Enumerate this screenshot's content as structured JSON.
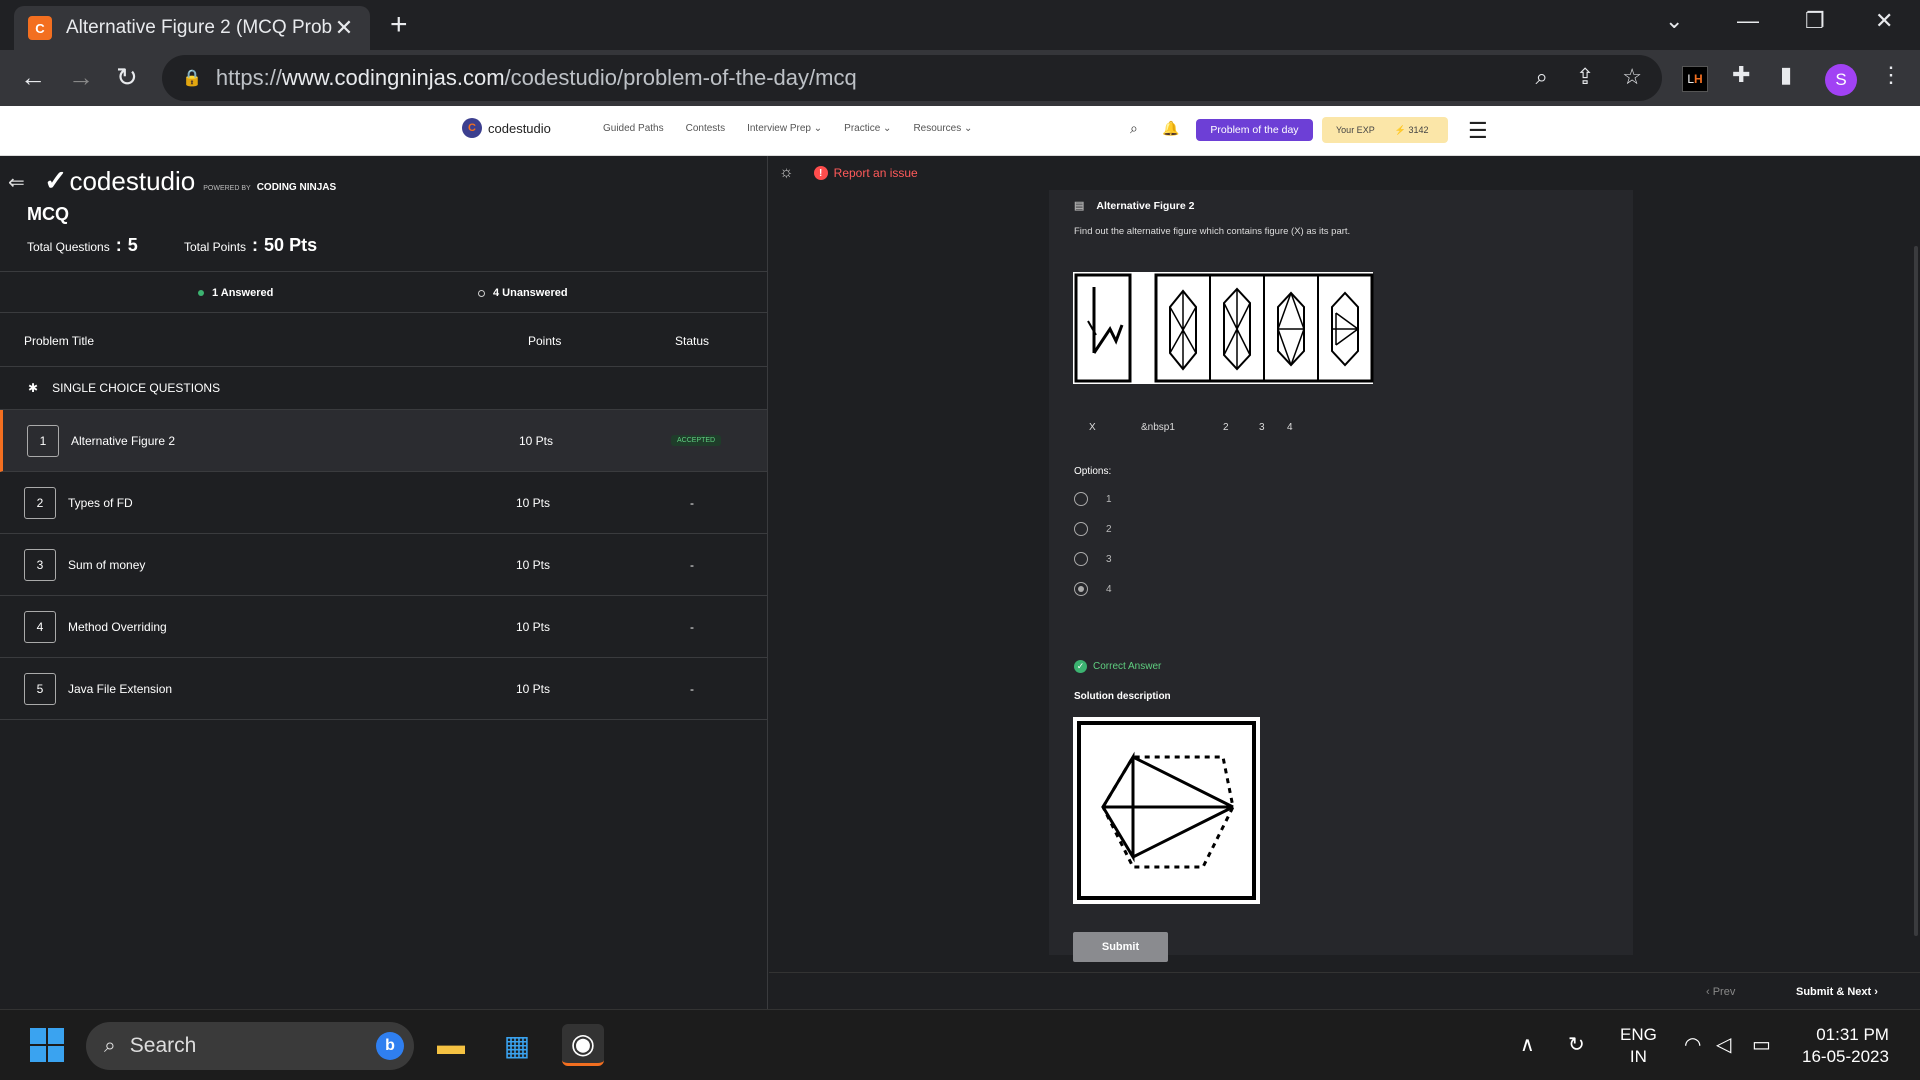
{
  "browser": {
    "tab_title": "Alternative Figure 2 (MCQ Proble",
    "tab_close": "✕",
    "new_tab": "+",
    "url_prefix": "https://",
    "url_domain": "www.codingninjas.com",
    "url_path": "/codestudio/problem-of-the-day/mcq",
    "profile_initial": "S",
    "ext_label_l": "L",
    "ext_label_h": "H"
  },
  "site": {
    "logo_text": "codestudio",
    "nav": [
      "Guided Paths",
      "Contests",
      "Interview Prep ⌄",
      "Practice ⌄",
      "Resources ⌄"
    ],
    "potd_label": "Problem of the day",
    "exp_label": "Your EXP",
    "exp_value": "3142"
  },
  "left": {
    "brand": "codestudio",
    "powered": "POWERED BY",
    "coding": "CODING NINJAS",
    "mcq_title": "MCQ",
    "total_questions_label": "Total Questions",
    "total_questions_value": "5",
    "total_points_label": "Total Points",
    "total_points_value": "50 Pts",
    "answered": "1 Answered",
    "unanswered": "4 Unanswered",
    "col_title": "Problem Title",
    "col_points": "Points",
    "col_status": "Status",
    "section": "SINGLE CHOICE QUESTIONS",
    "rows": [
      {
        "num": "1",
        "title": "Alternative Figure 2",
        "points": "10 Pts",
        "status": "ACCEPTED"
      },
      {
        "num": "2",
        "title": "Types of FD",
        "points": "10 Pts",
        "status": "-"
      },
      {
        "num": "3",
        "title": "Sum of money",
        "points": "10 Pts",
        "status": "-"
      },
      {
        "num": "4",
        "title": "Method Overriding",
        "points": "10 Pts",
        "status": "-"
      },
      {
        "num": "5",
        "title": "Java File Extension",
        "points": "10 Pts",
        "status": "-"
      }
    ]
  },
  "right": {
    "report": "Report an issue",
    "question_title": "Alternative Figure 2",
    "question_text": "Find out the alternative figure which contains figure (X) as its part.",
    "fig_labels": [
      "X",
      "&nbsp1",
      "2",
      "3",
      "4"
    ],
    "options_label": "Options:",
    "options": [
      "1",
      "2",
      "3",
      "4"
    ],
    "selected_option": "4",
    "correct": "Correct Answer",
    "solution_title": "Solution description",
    "submit": "Submit",
    "prev": "‹ Prev",
    "submit_next": "Submit & Next ›"
  },
  "taskbar": {
    "search": "Search",
    "lang1": "ENG",
    "lang2": "IN",
    "time": "01:31 PM",
    "date": "16-05-2023"
  },
  "colors": {
    "accent": "#f36f20",
    "potd": "#6d3fd6",
    "success": "#3cb371",
    "error": "#ff4d4d"
  }
}
